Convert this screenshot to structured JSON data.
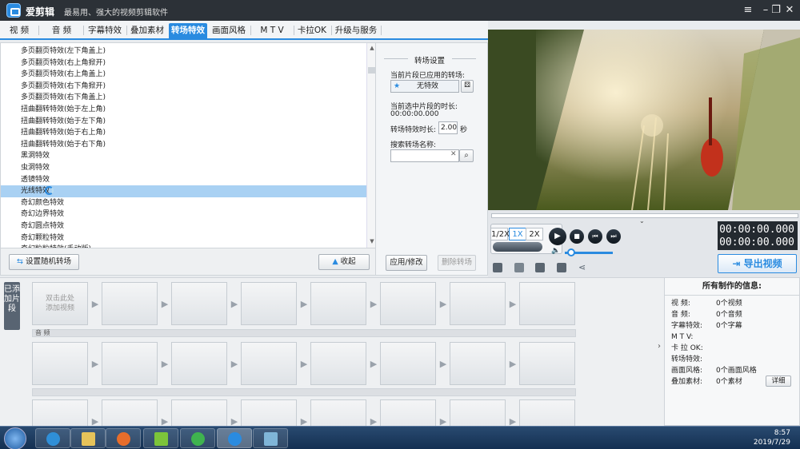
{
  "app": {
    "name": "爱剪辑",
    "slogan": "最易用、强大的视频剪辑软件"
  },
  "window_controls": {
    "menu": "≡",
    "minimize": "–",
    "restore": "❐",
    "close": "✕"
  },
  "tabs": [
    {
      "label": "视 频"
    },
    {
      "label": "音 频"
    },
    {
      "label": "字幕特效"
    },
    {
      "label": "叠加素材"
    },
    {
      "label": "转场特效",
      "active": true
    },
    {
      "label": "画面风格"
    },
    {
      "label": "M T V"
    },
    {
      "label": "卡拉OK"
    },
    {
      "label": "升级与服务"
    }
  ],
  "effects": [
    "多页翻页特效(左下角盖上)",
    "多页翻页特效(右上角掀开)",
    "多页翻页特效(右上角盖上)",
    "多页翻页特效(右下角掀开)",
    "多页翻页特效(右下角盖上)",
    "扭曲翻转特效(始于左上角)",
    "扭曲翻转特效(始于左下角)",
    "扭曲翻转特效(始于右上角)",
    "扭曲翻转特效(始于右下角)",
    "黑洞特效",
    "虫洞特效",
    "透镜特效",
    "光线特效",
    "奇幻颜色特效",
    "奇幻边界特效",
    "奇幻圆点特效",
    "奇幻颗粒特效",
    "奇幻粒粒特效(手动版)"
  ],
  "selected_effect_index": 12,
  "list_buttons": {
    "random": "设置随机转场",
    "collapse": "收起"
  },
  "settings": {
    "title": "转场设置",
    "applied_label": "当前片段已应用的转场:",
    "applied_value": "无特效",
    "duration_label": "当前选中片段的时长:",
    "duration_value": "00:00:00.000",
    "effect_duration_label": "转场特效时长:",
    "effect_duration_value": "2.00",
    "effect_duration_unit": "秒",
    "search_label": "搜索转场名称:",
    "search_value": "",
    "apply_button": "应用/修改",
    "delete_button": "删除转场"
  },
  "player": {
    "timecode_current": "00:00:00.000",
    "timecode_total": "00:00:00.000",
    "speeds": [
      "1/2X",
      "1X",
      "2X"
    ],
    "export_button": "导出视频"
  },
  "timeline": {
    "side_tab": "已添加片段",
    "add_video_hint": "双击此处添加视频",
    "audio_label": "音 频",
    "cut_icon": "✂"
  },
  "info": {
    "title": "所有制作的信息:",
    "rows": [
      {
        "key": "视    频:",
        "value": "0个视频"
      },
      {
        "key": "音    频:",
        "value": "0个音频"
      },
      {
        "key": "字幕特效:",
        "value": "0个字幕"
      },
      {
        "key": "M  T  V:",
        "value": ""
      },
      {
        "key": "卡 拉 OK:",
        "value": ""
      },
      {
        "key": "转场特效:",
        "value": ""
      },
      {
        "key": "画面风格:",
        "value": "0个画面风格"
      },
      {
        "key": "叠加素材:",
        "value": "0个素材"
      }
    ],
    "detail_button": "详细"
  },
  "taskbar": {
    "time": "8:57",
    "date": "2019/7/29"
  }
}
